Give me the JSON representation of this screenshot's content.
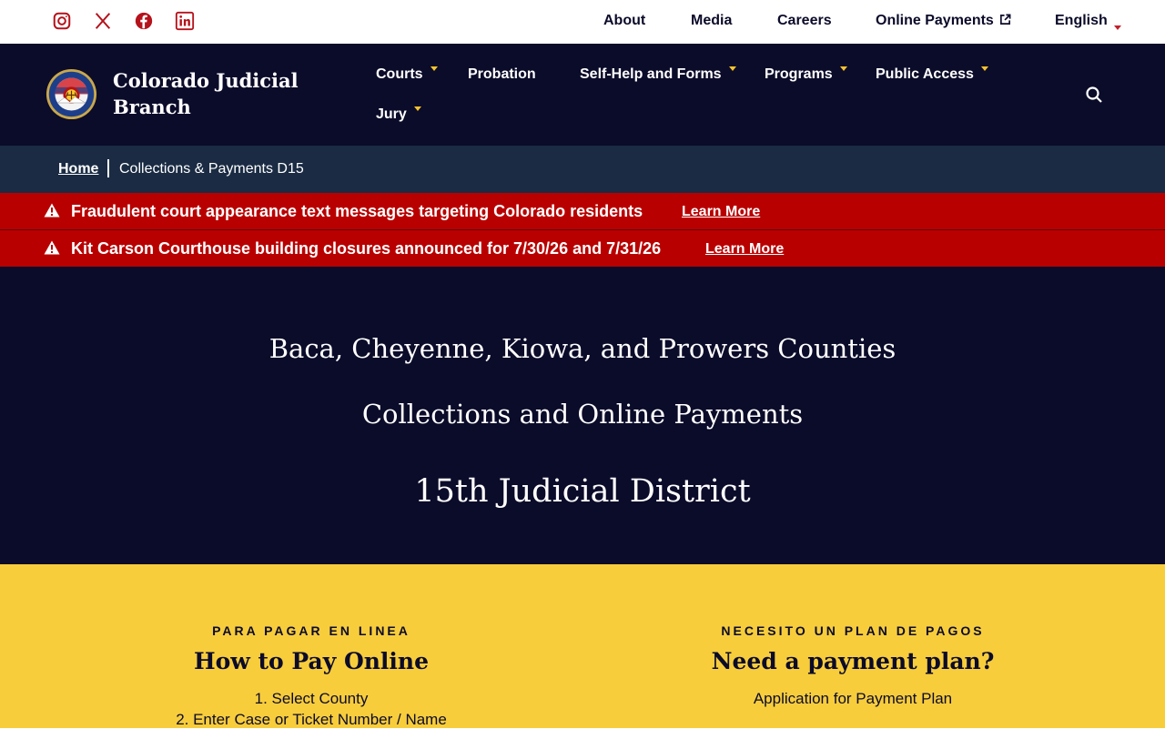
{
  "utility": {
    "social": [
      "instagram-icon",
      "x-icon",
      "facebook-icon",
      "linkedin-icon"
    ],
    "links": {
      "about": "About",
      "media": "Media",
      "careers": "Careers",
      "online_payments": "Online Payments",
      "language": "English"
    }
  },
  "header": {
    "brand": "Colorado Judicial Branch",
    "nav": {
      "courts": "Courts",
      "probation": "Probation",
      "self_help": "Self-Help and Forms",
      "programs": "Programs",
      "public_access": "Public Access",
      "jury": "Jury"
    }
  },
  "breadcrumb": {
    "home": "Home",
    "current": "Collections & Payments D15"
  },
  "alerts": [
    {
      "message": "Fraudulent court appearance text messages targeting Colorado residents",
      "link": "Learn More"
    },
    {
      "message": "Kit Carson Courthouse building closures announced for 7/30/26 and 7/31/26",
      "link": "Learn More"
    }
  ],
  "hero": {
    "line1": "Baca, Cheyenne, Kiowa, and Prowers Counties",
    "line2": "Collections and Online Payments",
    "line3": "15th Judicial District"
  },
  "sections": {
    "pay_online": {
      "eyebrow": "PARA PAGAR EN LINEA",
      "title": "How to Pay Online",
      "steps": [
        "1. Select County",
        "2. Enter Case or Ticket Number / Name"
      ]
    },
    "payment_plan": {
      "eyebrow": "NECESITO UN PLAN DE PAGOS",
      "title": "Need a payment plan?",
      "link": "Application for Payment Plan"
    }
  },
  "colors": {
    "navy": "#0b0b2a",
    "breadcrumb_bg": "#1a2b43",
    "alert_red": "#b90000",
    "accent_yellow": "#f8cd3c",
    "social_red": "#b5121b"
  }
}
